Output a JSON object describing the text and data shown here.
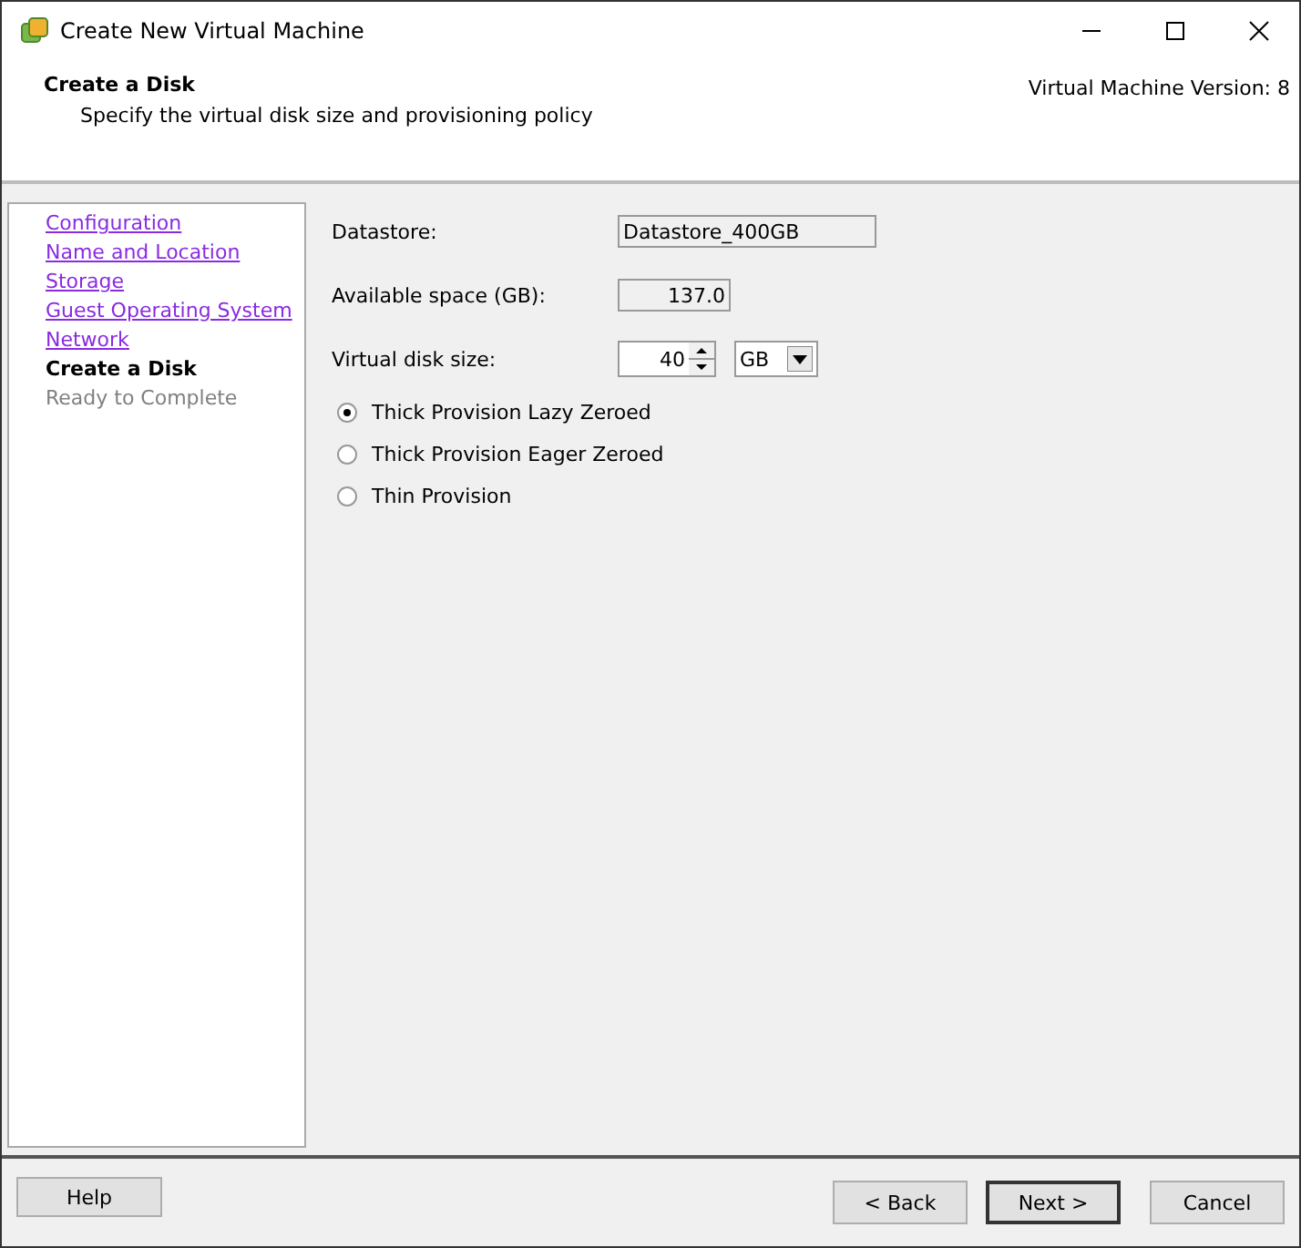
{
  "window": {
    "title": "Create New Virtual Machine"
  },
  "header": {
    "title": "Create a Disk",
    "subtitle": "Specify the virtual disk size and provisioning policy",
    "version": "Virtual Machine Version: 8"
  },
  "steps": [
    {
      "label": "Configuration",
      "kind": "link"
    },
    {
      "label": "Name and Location",
      "kind": "link"
    },
    {
      "label": "Storage",
      "kind": "link"
    },
    {
      "label": "Guest Operating System",
      "kind": "link"
    },
    {
      "label": "Network",
      "kind": "link"
    },
    {
      "label": "Create a Disk",
      "kind": "current"
    },
    {
      "label": "Ready to Complete",
      "kind": "pending"
    }
  ],
  "form": {
    "datastore_label": "Datastore:",
    "datastore": "Datastore_400GB",
    "available_label": "Available space (GB):",
    "available": "137.0",
    "size_label": "Virtual disk size:",
    "size": "40",
    "unit": "GB"
  },
  "provisioning": [
    {
      "label": "Thick Provision Lazy Zeroed",
      "selected": true
    },
    {
      "label": "Thick Provision Eager Zeroed",
      "selected": false
    },
    {
      "label": "Thin Provision",
      "selected": false
    }
  ],
  "buttons": [
    {
      "label": "Help",
      "kind": "help"
    },
    {
      "label": "< Back",
      "kind": "nav"
    },
    {
      "label": "Next >",
      "kind": "default"
    },
    {
      "label": "Cancel",
      "kind": "nav"
    }
  ]
}
